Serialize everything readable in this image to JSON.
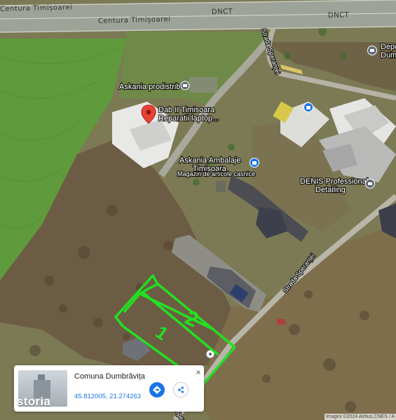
{
  "map": {
    "type": "satellite",
    "roads": {
      "centura_top": "Centura Timișoarei",
      "centura_left": "Centura Timișoarei",
      "dnct_1": "DNCT",
      "dnct_2": "DNCT",
      "strada_sperantei_top": "Strada Speranței",
      "strada_sperantei_right": "Strada Speranței",
      "strada_sperantei_bottom": "Sperant"
    },
    "pois": {
      "askania_prodistrib": "Askania prodistrib",
      "dab_line1": "Dab II Timisoara",
      "dab_line2": "Reparatii laptop...",
      "askania_ambalaje_line1": "Askania Ambalaje",
      "askania_ambalaje_line2": "Timișoara",
      "magazin": "Magazin de articole casnice",
      "denis_line1": "DENIS Professional",
      "denis_line2": "Detailing",
      "depo_line1": "Depo",
      "depo_line2": "Dum"
    },
    "plot_annotations": {
      "number_1": "1",
      "number_2": "2"
    }
  },
  "info_card": {
    "title": "Comuna Dumbrăvița",
    "coordinates": "45.812005, 21.274263"
  },
  "watermark": "storia",
  "attribution": "Imagini ©2024 Airbus,CNES / A",
  "colors": {
    "accent_blue": "#1a73e8",
    "marker_red": "#ea4335",
    "annotation_green": "#22e022"
  }
}
